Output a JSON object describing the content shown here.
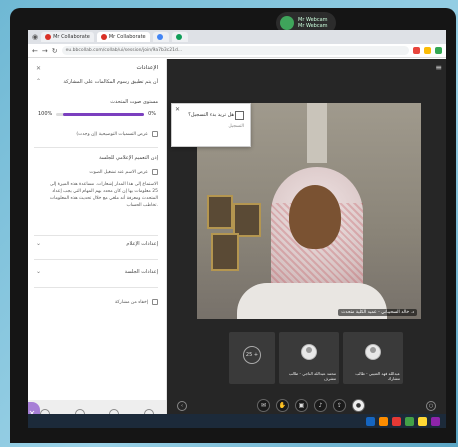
{
  "webcam": {
    "line1": "Mr Webcam",
    "line2": "Mr Webcam"
  },
  "browser": {
    "tabs": [
      {
        "label": "Mr Collaborate",
        "active": false
      },
      {
        "label": "Mr Collaborate",
        "active": true
      },
      {
        "label": "",
        "active": false
      },
      {
        "label": "",
        "active": false
      }
    ],
    "url": "eu.bbcollab.com/collab/ui/session/join/9a7b3c21d..."
  },
  "settings_panel": {
    "title": "الإعدادات",
    "section_1": "أن يتم تطبيق رسوم المكالمات على المشاركة",
    "section_2": "مستوى صوت المتحدث",
    "progress": {
      "left_label": "100%",
      "right_label": "0%",
      "value_fraction": 0.92
    },
    "checkbox_1": "عرض التسميات التوضيحية (إن وجدت)",
    "section_3": "إذن التعميم الإعلامي للجلسة",
    "checkbox_2": "عرض الاسم عند تشغيل الصوت",
    "paragraph": "الاستماع إلى هذا المدار إشعارات. مساعدة هذه الميزة إلى 25 معلومات بها إن كان محدد بهم المهام التي يجب إعداد المتحدث ومعرفة أنه ملغي مع خلال تحديث هذه المعلومات تخاطب الحساب.",
    "section_audio": "إعدادات الإعلام",
    "section_session": "إعدادات الجلسة",
    "checkbox_3": "إخفاء من مشاركة"
  },
  "popup": {
    "title": "هل تريد بدء التسجيل؟",
    "subtitle": "التسجيل"
  },
  "main_video": {
    "name_tag": "د. خالد السحيباني - عميد الكلية متحدث"
  },
  "participants": [
    {
      "name": "محمد عبدالله الناجي - طالب",
      "role": "مشرف"
    },
    {
      "name": "عبدالله فهد العتيبي - طالب",
      "role": "مشارك"
    }
  ],
  "more_participants": "25 +",
  "controls": [
    {
      "icon": "chat-icon",
      "label": ""
    },
    {
      "icon": "hand-icon",
      "label": ""
    },
    {
      "icon": "camera-off-icon",
      "label": ""
    },
    {
      "icon": "mic-off-icon",
      "label": ""
    },
    {
      "icon": "share-icon",
      "label": ""
    },
    {
      "icon": "avatar-icon",
      "label": ""
    }
  ],
  "colors": {
    "accent": "#7b3fbf",
    "panel_tab": "#a77fd6",
    "stage_bg": "#262626"
  }
}
